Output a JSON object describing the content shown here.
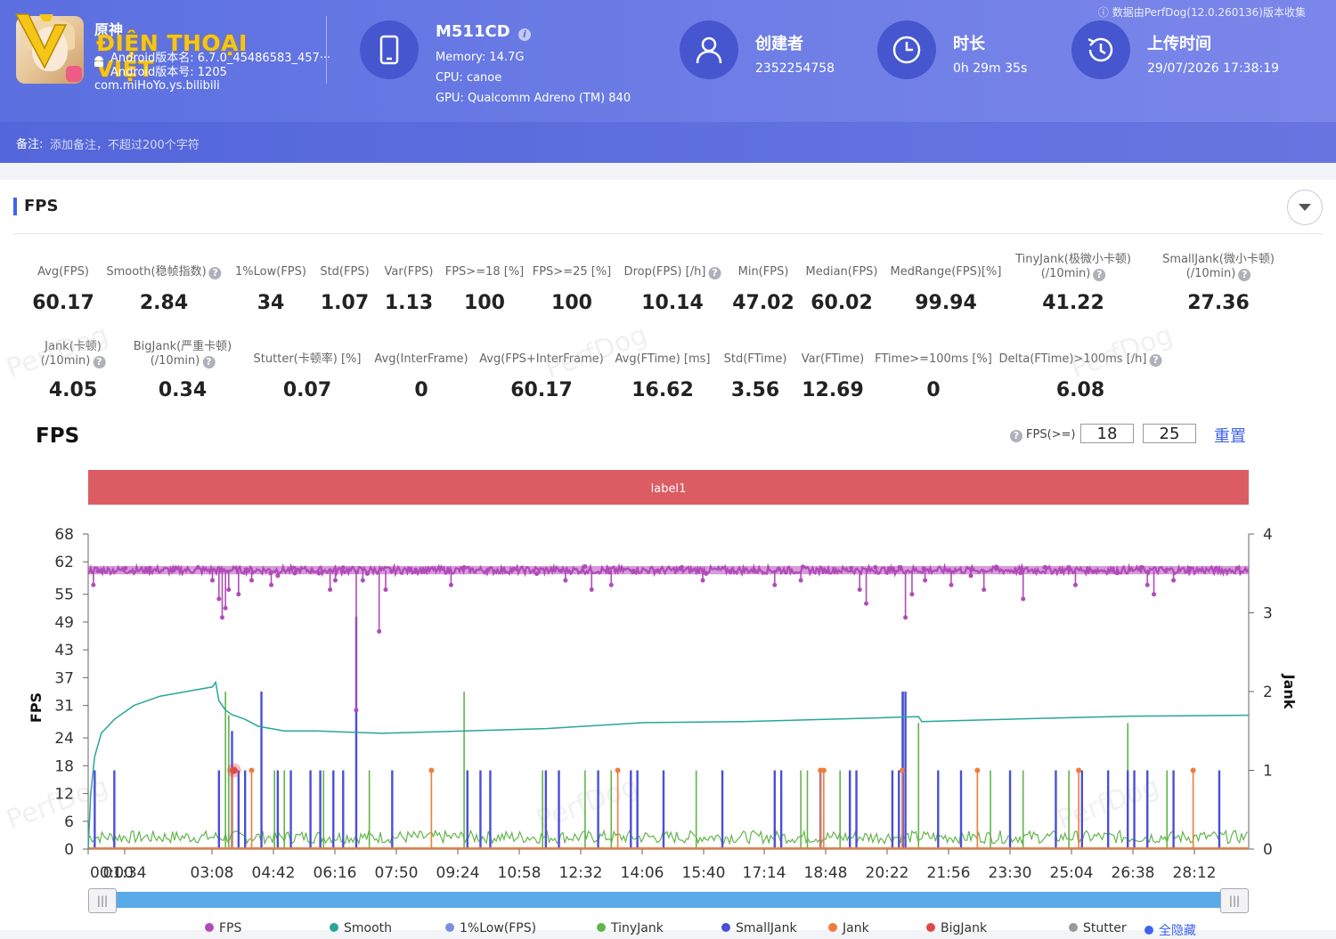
{
  "header": {
    "app": {
      "name": "原神",
      "android_version": "Android版本名: 6.7.0_45486583_457···",
      "android_code": "Android版本号: 1205",
      "package": "com.miHoYo.ys.bilibili",
      "overlay_logo_text": "ĐIỆN THOẠI VIỆT"
    },
    "device": {
      "model": "M511CD",
      "memory": "Memory: 14.7G",
      "cpu": "CPU: canoe",
      "gpu": "GPU: Qualcomm Adreno (TM) 840"
    },
    "creator": {
      "title": "创建者",
      "value": "2352254758"
    },
    "duration": {
      "title": "时长",
      "value": "0h 29m 35s"
    },
    "upload": {
      "title": "上传时间",
      "value": "29/07/2026 17:38:19"
    },
    "info": "数据由PerfDog(12.0.260136)版本收集",
    "note_label": "备注:",
    "note_placeholder": "添加备注，不超过200个字符"
  },
  "section": {
    "title": "FPS"
  },
  "metrics_row1": [
    {
      "label": "Avg(FPS)",
      "value": "60.17"
    },
    {
      "label": "Smooth(稳帧指数)",
      "value": "2.84",
      "help": true
    },
    {
      "label": "1%Low(FPS)",
      "value": "34"
    },
    {
      "label": "Std(FPS)",
      "value": "1.07"
    },
    {
      "label": "Var(FPS)",
      "value": "1.13"
    },
    {
      "label": "FPS>=18 [%]",
      "value": "100"
    },
    {
      "label": "FPS>=25 [%]",
      "value": "100"
    },
    {
      "label": "Drop(FPS) [/h]",
      "value": "10.14",
      "help": true
    },
    {
      "label": "Min(FPS)",
      "value": "47.02"
    },
    {
      "label": "Median(FPS)",
      "value": "60.02"
    },
    {
      "label": "MedRange(FPS)[%]",
      "value": "99.94"
    },
    {
      "label": "TinyJank(极微小卡顿)",
      "label2": "(/10min)",
      "value": "41.22",
      "help": true
    },
    {
      "label": "SmallJank(微小卡顿)",
      "label2": "(/10min)",
      "value": "27.36",
      "help": true
    }
  ],
  "metrics_row2": [
    {
      "label": "Jank(卡顿)",
      "label2": "(/10min)",
      "value": "4.05",
      "help": true
    },
    {
      "label": "BigJank(严重卡顿)",
      "label2": "(/10min)",
      "value": "0.34",
      "help": true
    },
    {
      "label": "Stutter(卡顿率) [%]",
      "value": "0.07"
    },
    {
      "label": "Avg(InterFrame)",
      "value": "0"
    },
    {
      "label": "Avg(FPS+InterFrame)",
      "value": "60.17"
    },
    {
      "label": "Avg(FTime) [ms]",
      "value": "16.62"
    },
    {
      "label": "Std(FTime)",
      "value": "3.56"
    },
    {
      "label": "Var(FTime)",
      "value": "12.69"
    },
    {
      "label": "FTime>=100ms [%]",
      "value": "0"
    },
    {
      "label": "Delta(FTime)>100ms [/h]",
      "value": "6.08",
      "help": true
    }
  ],
  "watermark": "PerfDog",
  "chart_panel": {
    "title": "FPS",
    "threshold_label": "FPS(>=)",
    "threshold_low": "18",
    "threshold_high": "25",
    "reset_label": "重置",
    "band_label": "label1"
  },
  "legend": [
    {
      "name": "FPS",
      "color": "#b14bb8"
    },
    {
      "name": "Smooth",
      "color": "#27a698"
    },
    {
      "name": "1%Low(FPS)",
      "color": "#7b8ee0"
    },
    {
      "name": "TinyJank",
      "color": "#62b54a"
    },
    {
      "name": "SmallJank",
      "color": "#4a4fd8"
    },
    {
      "name": "Jank",
      "color": "#f07c3c"
    },
    {
      "name": "BigJank",
      "color": "#e04848"
    },
    {
      "name": "Stutter",
      "color": "#999999"
    },
    {
      "name": "全隐藏",
      "color": "#3f63f0"
    }
  ],
  "chart_data": {
    "type": "line",
    "title": "FPS",
    "ylabel": "FPS",
    "y2label": "Jank",
    "yticks": [
      0,
      6,
      12,
      18,
      24,
      31,
      37,
      43,
      49,
      55,
      62,
      68
    ],
    "y2ticks": [
      0,
      1,
      2,
      3,
      4
    ],
    "ylim": [
      0,
      68
    ],
    "y2lim": [
      0,
      4
    ],
    "xticks": [
      "00:00",
      "01:34",
      "03:08",
      "04:42",
      "06:16",
      "07:50",
      "09:24",
      "10:58",
      "12:32",
      "14:06",
      "15:40",
      "17:14",
      "18:48",
      "20:22",
      "21:56",
      "23:30",
      "25:04",
      "26:38",
      "28:12"
    ],
    "xlim_seconds": [
      0,
      1775
    ],
    "series": [
      {
        "name": "FPS",
        "color": "#b14bb8",
        "baseline": 60.2,
        "dips": [
          [
            8,
            57
          ],
          [
            15,
            60
          ],
          [
            190,
            58
          ],
          [
            200,
            54
          ],
          [
            205,
            50
          ],
          [
            210,
            52
          ],
          [
            215,
            56
          ],
          [
            230,
            55
          ],
          [
            250,
            58
          ],
          [
            280,
            57
          ],
          [
            290,
            59
          ],
          [
            370,
            56
          ],
          [
            378,
            58
          ],
          [
            410,
            30
          ],
          [
            420,
            58
          ],
          [
            445,
            47
          ],
          [
            455,
            56
          ],
          [
            555,
            57
          ],
          [
            730,
            58
          ],
          [
            770,
            56
          ],
          [
            800,
            57
          ],
          [
            940,
            58
          ],
          [
            1050,
            57
          ],
          [
            1090,
            58
          ],
          [
            1180,
            56
          ],
          [
            1190,
            53
          ],
          [
            1250,
            50
          ],
          [
            1260,
            55
          ],
          [
            1280,
            58
          ],
          [
            1320,
            57
          ],
          [
            1350,
            59
          ],
          [
            1370,
            56
          ],
          [
            1430,
            54
          ],
          [
            1510,
            57
          ],
          [
            1620,
            57
          ],
          [
            1630,
            55
          ],
          [
            1660,
            58
          ]
        ]
      },
      {
        "name": "Smooth",
        "color": "#27a698",
        "points": [
          [
            0,
            0
          ],
          [
            4,
            12
          ],
          [
            10,
            20
          ],
          [
            20,
            25
          ],
          [
            40,
            28
          ],
          [
            70,
            31
          ],
          [
            110,
            33
          ],
          [
            150,
            34
          ],
          [
            190,
            35
          ],
          [
            195,
            36
          ],
          [
            200,
            32
          ],
          [
            210,
            30
          ],
          [
            220,
            29
          ],
          [
            240,
            28
          ],
          [
            260,
            26.5
          ],
          [
            300,
            25.5
          ],
          [
            350,
            25.5
          ],
          [
            450,
            25
          ],
          [
            700,
            26
          ],
          [
            850,
            27.3
          ],
          [
            1000,
            27.5
          ],
          [
            1200,
            28.3
          ],
          [
            1270,
            28.6
          ],
          [
            1275,
            27.5
          ],
          [
            1400,
            28
          ],
          [
            1600,
            28.7
          ],
          [
            1775,
            28.9
          ]
        ]
      },
      {
        "name": "TinyJank",
        "color": "#62b54a",
        "axis": "y2",
        "noise_level": 0.18,
        "spikes": [
          [
            210,
            2
          ],
          [
            215,
            1.7
          ],
          [
            285,
            1
          ],
          [
            300,
            1
          ],
          [
            360,
            1
          ],
          [
            430,
            1
          ],
          [
            575,
            2
          ],
          [
            695,
            1
          ],
          [
            760,
            1
          ],
          [
            800,
            1
          ],
          [
            930,
            1
          ],
          [
            1090,
            1
          ],
          [
            1100,
            1
          ],
          [
            1150,
            1
          ],
          [
            1245,
            2
          ],
          [
            1250,
            1
          ],
          [
            1270,
            1.6
          ],
          [
            1380,
            1
          ],
          [
            1430,
            1
          ],
          [
            1500,
            1
          ],
          [
            1590,
            1.6
          ],
          [
            1650,
            1
          ]
        ]
      },
      {
        "name": "SmallJank",
        "color": "#4a4fd8",
        "axis": "y2",
        "spikes": [
          [
            10,
            1
          ],
          [
            40,
            1
          ],
          [
            200,
            1
          ],
          [
            220,
            1.5
          ],
          [
            230,
            1
          ],
          [
            240,
            1
          ],
          [
            265,
            2
          ],
          [
            290,
            1
          ],
          [
            310,
            1
          ],
          [
            340,
            1
          ],
          [
            355,
            1
          ],
          [
            375,
            1
          ],
          [
            390,
            1
          ],
          [
            410,
            2.95
          ],
          [
            465,
            1
          ],
          [
            580,
            1
          ],
          [
            600,
            1
          ],
          [
            615,
            1
          ],
          [
            700,
            1
          ],
          [
            720,
            1
          ],
          [
            780,
            1
          ],
          [
            830,
            1
          ],
          [
            840,
            1
          ],
          [
            880,
            1
          ],
          [
            970,
            1
          ],
          [
            1050,
            1
          ],
          [
            1060,
            1
          ],
          [
            1120,
            1
          ],
          [
            1165,
            1
          ],
          [
            1175,
            1
          ],
          [
            1230,
            1
          ],
          [
            1240,
            1
          ],
          [
            1246,
            2
          ],
          [
            1250,
            2
          ],
          [
            1300,
            1
          ],
          [
            1335,
            1
          ],
          [
            1410,
            1
          ],
          [
            1480,
            1
          ],
          [
            1520,
            1
          ],
          [
            1560,
            1
          ],
          [
            1590,
            1
          ],
          [
            1600,
            1
          ],
          [
            1620,
            1
          ],
          [
            1660,
            1
          ],
          [
            1730,
            1
          ]
        ]
      },
      {
        "name": "Jank",
        "color": "#f07c3c",
        "axis": "y2",
        "spikes": [
          [
            220,
            1
          ],
          [
            250,
            1
          ],
          [
            525,
            1
          ],
          [
            810,
            1
          ],
          [
            1120,
            1
          ],
          [
            1125,
            1
          ],
          [
            1245,
            1
          ],
          [
            1360,
            1
          ],
          [
            1515,
            1
          ],
          [
            1690,
            1
          ]
        ]
      },
      {
        "name": "BigJank",
        "color": "#e04848",
        "axis": "y2",
        "spikes": [
          [
            223,
            1
          ]
        ]
      }
    ]
  }
}
